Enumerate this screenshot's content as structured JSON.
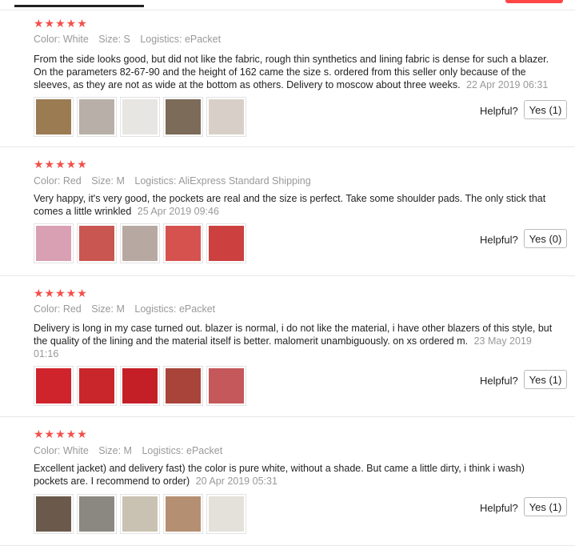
{
  "reviews": [
    {
      "stars": "★★★★★",
      "color": "Color: White",
      "size": "Size: S",
      "logistics": "Logistics: ePacket",
      "text": "From the side looks good, but did not like the fabric, rough thin synthetics and lining fabric is dense for such a blazer. On the parameters 82-67-90 and the height of 162 came the size s. ordered from this seller only because of the sleeves, as they are not as wide at the bottom as others. Delivery to moscow about three weeks.",
      "date": "22 Apr 2019 06:31",
      "helpful_label": "Helpful?",
      "yes_label": "Yes (1)",
      "photos": [
        "#9a7b52",
        "#b8b0a8",
        "#e8e6e2",
        "#7c6b58",
        "#d8d0c8"
      ]
    },
    {
      "stars": "★★★★★",
      "color": "Color: Red",
      "size": "Size: M",
      "logistics": "Logistics: AliExpress Standard Shipping",
      "text": "Very happy, it's very good, the pockets are real and the size is perfect. Take some shoulder pads. The only stick that comes a little wrinkled",
      "date": "25 Apr 2019 09:46",
      "helpful_label": "Helpful?",
      "yes_label": "Yes (0)",
      "photos": [
        "#d9a0b4",
        "#c95650",
        "#b7a9a2",
        "#d6524e",
        "#cc4040"
      ]
    },
    {
      "stars": "★★★★★",
      "color": "Color: Red",
      "size": "Size: M",
      "logistics": "Logistics: ePacket",
      "text": "Delivery is long in my case turned out. blazer is normal, i do not like the material, i have other blazers of this style, but the quality of the lining and the material itself is better. malomerit unambiguously. on xs ordered m.",
      "date": "23 May 2019 01:16",
      "helpful_label": "Helpful?",
      "yes_label": "Yes (1)",
      "photos": [
        "#d0242c",
        "#c8262a",
        "#c41f26",
        "#a8443a",
        "#c4585a"
      ]
    },
    {
      "stars": "★★★★★",
      "color": "Color: White",
      "size": "Size: M",
      "logistics": "Logistics: ePacket",
      "text": "Excellent jacket) and delivery fast) the color is pure white, without a shade. But came a little dirty, i think i wash) pockets are. I recommend to order)",
      "date": "20 Apr 2019 05:31",
      "helpful_label": "Helpful?",
      "yes_label": "Yes (1)",
      "photos": [
        "#6b5a4c",
        "#8a8880",
        "#c9c2b2",
        "#b58f72",
        "#e4e0da"
      ]
    }
  ]
}
